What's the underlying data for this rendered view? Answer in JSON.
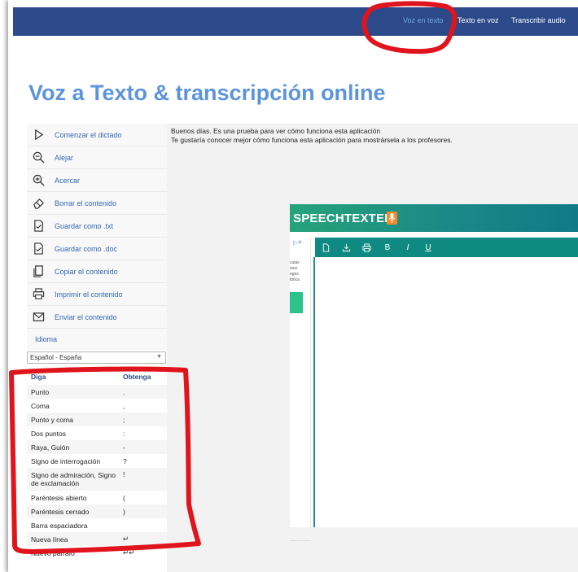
{
  "nav": {
    "items": [
      "Voz en texto",
      "Texto en voz",
      "Transcribir audio"
    ]
  },
  "page": {
    "title": "Voz a Texto & transcripción online"
  },
  "sidebar": {
    "items": [
      {
        "label": "Comenzar el dictado",
        "icon": "play-icon"
      },
      {
        "label": "Alejar",
        "icon": "zoom-out-icon"
      },
      {
        "label": "Acercar",
        "icon": "zoom-in-icon"
      },
      {
        "label": "Borrar el contenido",
        "icon": "eraser-icon"
      },
      {
        "label": "Guardar como .txt",
        "icon": "save-txt-icon"
      },
      {
        "label": "Guardar como .doc",
        "icon": "save-doc-icon"
      },
      {
        "label": "Copiar el contenido",
        "icon": "copy-icon"
      },
      {
        "label": "Imprimir el contenido",
        "icon": "print-icon"
      },
      {
        "label": "Enviar el contenido",
        "icon": "envelope-icon"
      }
    ],
    "language_label": "Idioma",
    "language_value": "Español - España"
  },
  "commands": {
    "headers": [
      "Diga",
      "Obtenga"
    ],
    "rows": [
      [
        "Punto",
        "."
      ],
      [
        "Coma",
        ","
      ],
      [
        "Punto y coma",
        ";"
      ],
      [
        "Dos puntos",
        ":"
      ],
      [
        "Raya, Guión",
        "-"
      ],
      [
        "Signo de interrogación",
        "?"
      ],
      [
        "Signo de admiración, Signo de exclamación",
        "!"
      ],
      [
        "Paréntesis abierto",
        "("
      ],
      [
        "Paréntesis cerrado",
        ")"
      ],
      [
        "Barra espaciadora",
        ""
      ],
      [
        "Nueva línea",
        "↵"
      ],
      [
        "Nuevo párrafo",
        "↵↵"
      ]
    ]
  },
  "editor": {
    "lines": [
      "Buenos días. Es una prueba para ver cómo funciona esta aplicación",
      "Te gustaría conocer mejor cómo funciona esta aplicación para mostrársela a los profesores."
    ]
  },
  "overlay": {
    "brand": "SPEECHTEXTER",
    "ad_text": [
      "culas",
      "sica",
      "egos",
      "ibrica"
    ],
    "toolbar": [
      {
        "icon": "new-document-icon"
      },
      {
        "icon": "download-icon"
      },
      {
        "icon": "print-icon"
      },
      {
        "label": "B",
        "icon": "bold-icon"
      },
      {
        "label": "I",
        "icon": "italic-icon"
      },
      {
        "label": "U",
        "icon": "underline-icon"
      }
    ]
  },
  "colors": {
    "nav_bg": "#2c4a8a",
    "nav_active": "#6ea7e8",
    "title": "#5c94dc",
    "link": "#3567b0",
    "annotation": "#e0141c",
    "speechtexter_green": "#26a37b",
    "speechtexter_toolbar": "#0f8a82"
  }
}
